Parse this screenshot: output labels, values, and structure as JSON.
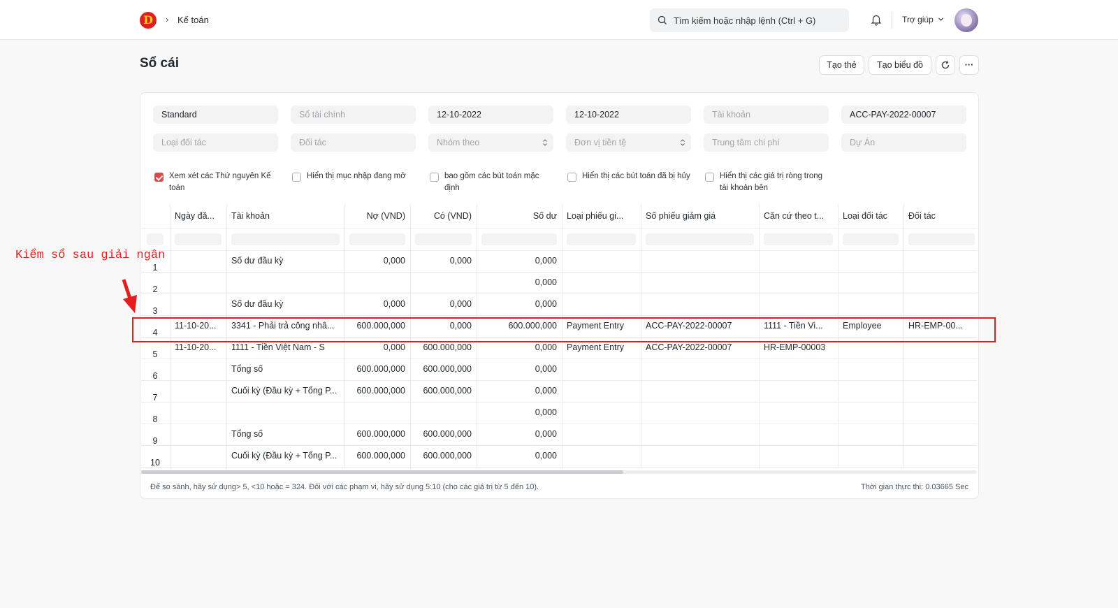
{
  "navbar": {
    "logo_letter": "D",
    "breadcrumb": "Kế toán",
    "search_placeholder": "Tìm kiếm hoặc nhập lệnh (Ctrl + G)",
    "help_label": "Trợ giúp"
  },
  "page": {
    "title": "Sổ cái",
    "buttons": {
      "card": "Tạo thẻ",
      "chart": "Tạo biểu đồ",
      "more": "···"
    }
  },
  "filters": {
    "row1": [
      "Standard",
      "Sổ tài chính",
      "12-10-2022",
      "12-10-2022",
      "Tài khoản",
      "ACC-PAY-2022-00007"
    ],
    "row2": [
      "Loại đối tác",
      "Đối tác",
      "Nhóm theo",
      "Đơn vị tiền tệ",
      "Trung tâm chi phí",
      "Dự Án"
    ],
    "checkboxes": [
      {
        "label": "Xem xét các Thứ nguyên Kế toán",
        "checked": true
      },
      {
        "label": "Hiển thị mục nhập đang mở",
        "checked": false
      },
      {
        "label": "bao gồm các bút toán mặc định",
        "checked": false
      },
      {
        "label": "Hiển thị các bút toán đã bị hủy",
        "checked": false
      },
      {
        "label": "Hiển thị các giá trị ròng trong tài khoản bên",
        "checked": false
      }
    ]
  },
  "table": {
    "columns": [
      "Ngày đă...",
      "Tài khoản",
      "Nợ (VND)",
      "Có (VND)",
      "Số dư",
      "Loại phiếu gi...",
      "Số phiếu giảm giá",
      "Căn cứ theo t...",
      "Loại đối tác",
      "Đối tác"
    ],
    "rows": [
      {
        "n": "1",
        "cells": [
          "",
          "Số dư đầu kỳ",
          "0,000",
          "0,000",
          "0,000",
          "",
          "",
          "",
          "",
          ""
        ]
      },
      {
        "n": "2",
        "cells": [
          "",
          "",
          "",
          "",
          "0,000",
          "",
          "",
          "",
          "",
          ""
        ]
      },
      {
        "n": "3",
        "cells": [
          "",
          "Số dư đầu kỳ",
          "0,000",
          "0,000",
          "0,000",
          "",
          "",
          "",
          "",
          ""
        ]
      },
      {
        "n": "4",
        "cells": [
          "11-10-20...",
          "3341 - Phải trả công nhâ...",
          "600.000,000",
          "0,000",
          "600.000,000",
          "Payment Entry",
          "ACC-PAY-2022-00007",
          "1111 - Tiền Vi...",
          "Employee",
          "HR-EMP-00..."
        ]
      },
      {
        "n": "5",
        "cells": [
          "11-10-20...",
          "1111 - Tiền Việt Nam - S",
          "0,000",
          "600.000,000",
          "0,000",
          "Payment Entry",
          "ACC-PAY-2022-00007",
          "HR-EMP-00003",
          "",
          ""
        ]
      },
      {
        "n": "6",
        "cells": [
          "",
          "Tổng số",
          "600.000,000",
          "600.000,000",
          "0,000",
          "",
          "",
          "",
          "",
          ""
        ]
      },
      {
        "n": "7",
        "cells": [
          "",
          "Cuối kỳ (Đầu kỳ + Tổng P...",
          "600.000,000",
          "600.000,000",
          "0,000",
          "",
          "",
          "",
          "",
          ""
        ]
      },
      {
        "n": "8",
        "cells": [
          "",
          "",
          "",
          "",
          "0,000",
          "",
          "",
          "",
          "",
          ""
        ]
      },
      {
        "n": "9",
        "cells": [
          "",
          "Tổng số",
          "600.000,000",
          "600.000,000",
          "0,000",
          "",
          "",
          "",
          "",
          ""
        ]
      },
      {
        "n": "10",
        "cells": [
          "",
          "Cuối kỳ (Đầu kỳ + Tổng P...",
          "600.000,000",
          "600.000,000",
          "0,000",
          "",
          "",
          "",
          "",
          ""
        ]
      }
    ],
    "footer_hint": "Để so sánh, hãy sử dụng> 5, <10 hoặc = 324. Đối với các phạm vi, hãy sử dụng 5:10 (cho các giá trị từ 5 đến 10).",
    "footer_time": "Thời gian thực thi: 0.03665 Sec"
  },
  "annotation": {
    "text": "Kiểm sổ sau giải ngân",
    "color": "#e41e1e"
  }
}
